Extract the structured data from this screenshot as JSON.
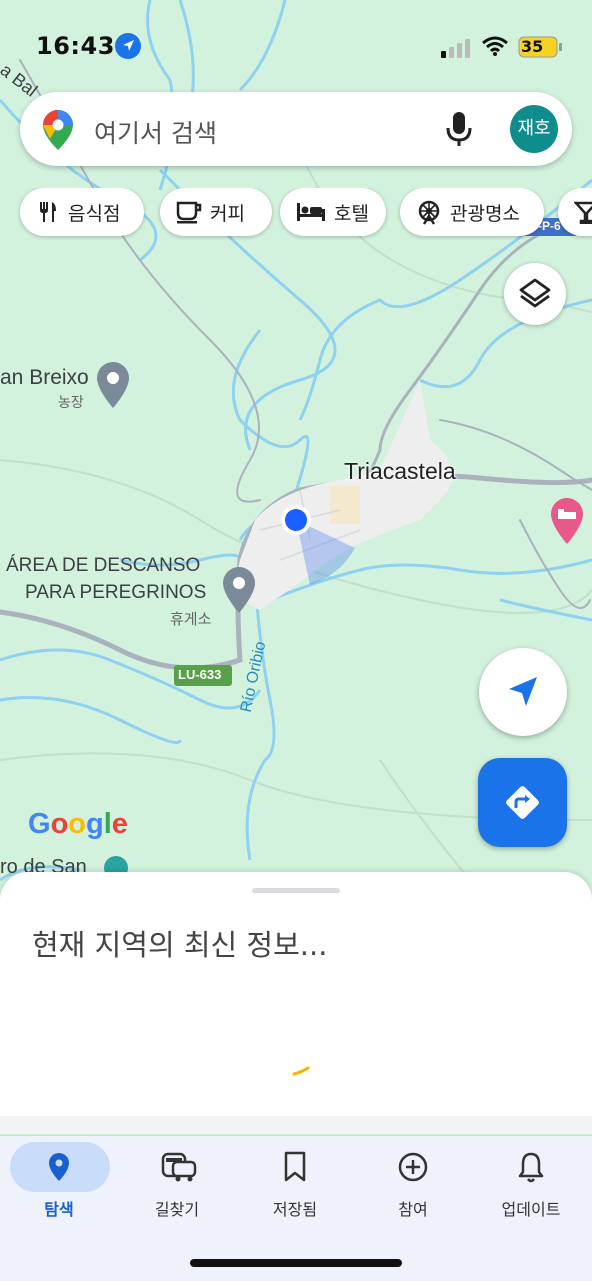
{
  "status_bar": {
    "time": "16:43",
    "battery": "35"
  },
  "search": {
    "placeholder": "여기서 검색",
    "avatar_text": "재호"
  },
  "chips": [
    {
      "label": "음식점",
      "icon": "restaurant-icon"
    },
    {
      "label": "커피",
      "icon": "coffee-icon"
    },
    {
      "label": "호텔",
      "icon": "hotel-icon"
    },
    {
      "label": "관광명소",
      "icon": "attraction-icon"
    }
  ],
  "map": {
    "labels": {
      "partial_top": "a Bal",
      "san_breixo": "an Breixo",
      "san_breixo_sub": "농장",
      "town": "Triacastela",
      "rest_area_1": "ÁREA DE DESCANSO",
      "rest_area_2": "PARA PEREGRINOS",
      "rest_area_sub": "휴게소",
      "river": "Río Oribio",
      "road_badge": "LU-633",
      "road_badge_top": "-P-6",
      "bottom_partial": "ro de San",
      "google": "Google"
    },
    "colors": {
      "land": "#d2f2dd",
      "water": "#8ed1f0",
      "road": "#a9b2bd",
      "town": "#eeeeee",
      "accent": "#1a73e8"
    }
  },
  "sheet": {
    "title": "현재 지역의 최신 정보..."
  },
  "bottom_nav": [
    {
      "label": "탐색",
      "icon": "explore-pin-icon",
      "active": true
    },
    {
      "label": "길찾기",
      "icon": "car-icon",
      "active": false
    },
    {
      "label": "저장됨",
      "icon": "bookmark-icon",
      "active": false
    },
    {
      "label": "참여",
      "icon": "add-circle-icon",
      "active": false
    },
    {
      "label": "업데이트",
      "icon": "bell-icon",
      "active": false
    }
  ]
}
